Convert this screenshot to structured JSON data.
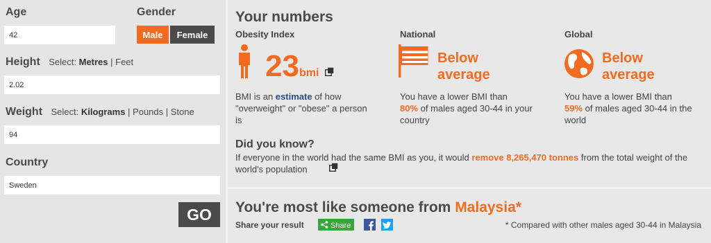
{
  "form": {
    "age_label": "Age",
    "age_value": "42",
    "gender_label": "Gender",
    "gender_options": [
      "Male",
      "Female"
    ],
    "gender_selected": "Male",
    "height_label": "Height",
    "height_select_prefix": "Select:",
    "height_units": [
      "Metres",
      "Feet"
    ],
    "height_value": "2.02",
    "weight_label": "Weight",
    "weight_select_prefix": "Select:",
    "weight_units": [
      "Kilograms",
      "Pounds",
      "Stone"
    ],
    "weight_value": "94",
    "country_label": "Country",
    "country_value": "Sweden",
    "go_label": "GO"
  },
  "results": {
    "title": "Your numbers",
    "obesity": {
      "heading": "Obesity Index",
      "value": "23",
      "unit": "bmi",
      "desc_1": "BMI is an ",
      "desc_link": "estimate",
      "desc_2": " of how \"overweight\" or \"obese\" a person is"
    },
    "national": {
      "heading": "National",
      "status_line1": "Below",
      "status_line2": "average",
      "desc_1": "You have a lower BMI than",
      "percent": "80%",
      "desc_2": " of males aged 30-44 in your country"
    },
    "global": {
      "heading": "Global",
      "status_line1": "Below",
      "status_line2": "average",
      "desc_1": "You have a lower BMI than",
      "percent": "59%",
      "desc_2": " of males aged 30-44 in the world"
    },
    "did_you_know": {
      "heading": "Did you know?",
      "text_1": "If everyone in the world had the same BMI as you, it would ",
      "highlight": "remove 8,265,470 tonnes",
      "text_2": " from the total weight of the world's population"
    },
    "most_like": {
      "prefix": "You're most like someone from ",
      "country": "Malaysia*",
      "share_label": "Share your result",
      "share_button": "Share",
      "footnote": "* Compared with other males aged 30-44 in Malaysia"
    }
  },
  "colors": {
    "accent": "#f26b21",
    "dark": "#4a4a4a",
    "share_green": "#3aa63a",
    "facebook": "#3b5998",
    "twitter": "#1da1f2"
  },
  "icons": [
    "person-icon",
    "popup-icon",
    "flag-icon",
    "globe-icon",
    "share-icon",
    "facebook-icon",
    "twitter-icon"
  ]
}
